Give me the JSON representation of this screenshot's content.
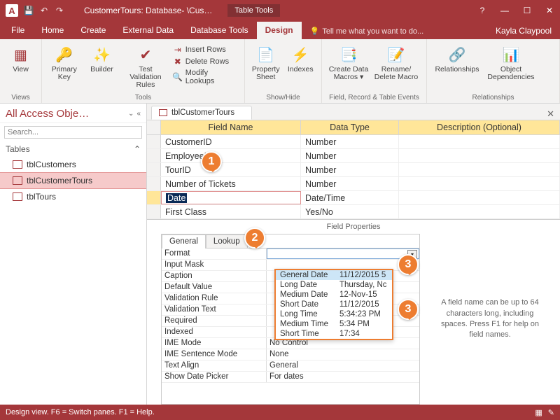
{
  "titlebar": {
    "app_initial": "A",
    "title": "CustomerTours: Database- \\Cus…",
    "contextual_label": "Table Tools"
  },
  "ribbon_tabs": {
    "file": "File",
    "home": "Home",
    "create": "Create",
    "external": "External Data",
    "dbtools": "Database Tools",
    "design": "Design",
    "tellme": "Tell me what you want to do...",
    "user": "Kayla Claypool"
  },
  "ribbon": {
    "views": {
      "view": "View",
      "group": "Views"
    },
    "tools": {
      "primary_key": "Primary\nKey",
      "builder": "Builder",
      "test_validation": "Test Validation\nRules",
      "insert_rows": "Insert Rows",
      "delete_rows": "Delete Rows",
      "modify_lookups": "Modify Lookups",
      "group": "Tools"
    },
    "showhide": {
      "property_sheet": "Property\nSheet",
      "indexes": "Indexes",
      "group": "Show/Hide"
    },
    "events": {
      "create_macros": "Create Data\nMacros ▾",
      "delete_macro": "Rename/\nDelete Macro",
      "group": "Field, Record & Table Events"
    },
    "relationships": {
      "relationships": "Relationships",
      "obj_dep": "Object\nDependencies",
      "group": "Relationships"
    }
  },
  "nav": {
    "title": "All Access Obje…",
    "search_placeholder": "Search...",
    "section": "Tables",
    "items": [
      {
        "label": "tblCustomers"
      },
      {
        "label": "tblCustomerTours"
      },
      {
        "label": "tblTours"
      }
    ]
  },
  "doc": {
    "tab": "tblCustomerTours"
  },
  "grid": {
    "headers": {
      "field": "Field Name",
      "type": "Data Type",
      "desc": "Description (Optional)"
    },
    "rows": [
      {
        "field": "CustomerID",
        "type": "Number"
      },
      {
        "field": "EmployeeID",
        "type": "Number"
      },
      {
        "field": "TourID",
        "type": "Number"
      },
      {
        "field": "Number of Tickets",
        "type": "Number"
      },
      {
        "field": "Date",
        "type": "Date/Time"
      },
      {
        "field": "First Class",
        "type": "Yes/No"
      }
    ]
  },
  "field_props": {
    "label": "Field Properties",
    "tabs": {
      "general": "General",
      "lookup": "Lookup"
    },
    "rows": [
      {
        "k": "Format",
        "v": ""
      },
      {
        "k": "Input Mask",
        "v": ""
      },
      {
        "k": "Caption",
        "v": ""
      },
      {
        "k": "Default Value",
        "v": ""
      },
      {
        "k": "Validation Rule",
        "v": ""
      },
      {
        "k": "Validation Text",
        "v": ""
      },
      {
        "k": "Required",
        "v": ""
      },
      {
        "k": "Indexed",
        "v": ""
      },
      {
        "k": "IME Mode",
        "v": "No Control"
      },
      {
        "k": "IME Sentence Mode",
        "v": "None"
      },
      {
        "k": "Text Align",
        "v": "General"
      },
      {
        "k": "Show Date Picker",
        "v": "For dates"
      }
    ],
    "hint": "A field name can be up to 64 characters long, including spaces. Press F1 for help on field names."
  },
  "format_dropdown": [
    {
      "k": "General Date",
      "v": "11/12/2015 5"
    },
    {
      "k": "Long Date",
      "v": "Thursday, Nc"
    },
    {
      "k": "Medium Date",
      "v": "12-Nov-15"
    },
    {
      "k": "Short Date",
      "v": "11/12/2015"
    },
    {
      "k": "Long Time",
      "v": "5:34:23 PM"
    },
    {
      "k": "Medium Time",
      "v": "5:34 PM"
    },
    {
      "k": "Short Time",
      "v": "17:34"
    }
  ],
  "callouts": {
    "c1": "1",
    "c2": "2",
    "c3a": "3",
    "c3b": "3"
  },
  "status": {
    "text": "Design view.   F6 = Switch panes.   F1 = Help."
  }
}
